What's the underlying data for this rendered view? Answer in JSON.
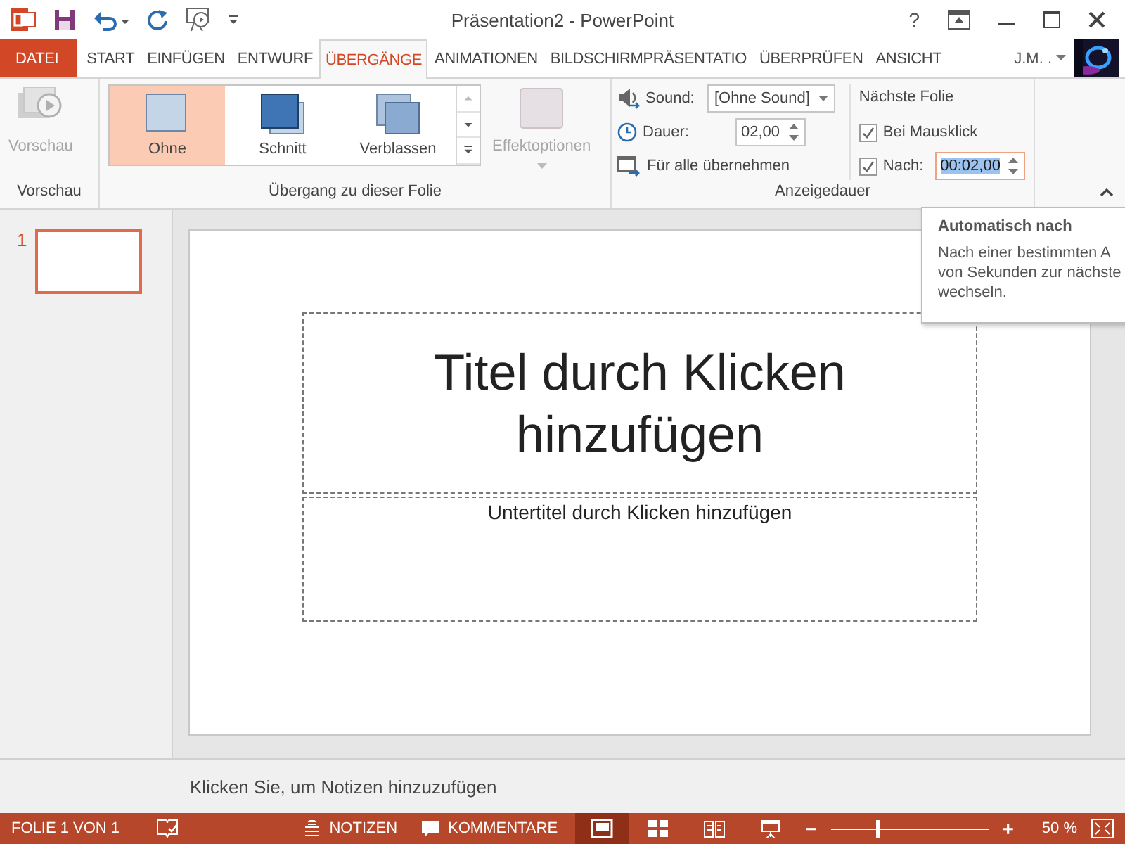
{
  "window": {
    "title": "Präsentation2 - PowerPoint",
    "help": "?"
  },
  "tabs": [
    {
      "label": "DATEI",
      "kind": "file",
      "selected": false
    },
    {
      "label": "START",
      "kind": "tab",
      "selected": false
    },
    {
      "label": "EINFÜGEN",
      "kind": "tab",
      "selected": false
    },
    {
      "label": "ENTWURF",
      "kind": "tab",
      "selected": false
    },
    {
      "label": "ÜBERGÄNGE",
      "kind": "tab",
      "selected": true
    },
    {
      "label": "ANIMATIONEN",
      "kind": "tab",
      "selected": false
    },
    {
      "label": "BILDSCHIRMPRÄSENTATIO",
      "kind": "tab",
      "selected": false
    },
    {
      "label": "ÜBERPRÜFEN",
      "kind": "tab",
      "selected": false
    },
    {
      "label": "ANSICHT",
      "kind": "tab",
      "selected": false
    }
  ],
  "user": {
    "name": "J.M. ."
  },
  "ribbon": {
    "preview_group": {
      "button": "Vorschau",
      "disabled": true,
      "label": "Vorschau"
    },
    "transition_group": {
      "label": "Übergang zu dieser Folie",
      "items": [
        {
          "label": "Ohne",
          "kind": "none",
          "selected": true
        },
        {
          "label": "Schnitt",
          "kind": "cut",
          "selected": false
        },
        {
          "label": "Verblassen",
          "kind": "fade",
          "selected": false
        }
      ],
      "effect_options": {
        "label": "Effektoptionen",
        "disabled": true
      }
    },
    "timing_group": {
      "label": "Anzeigedauer",
      "sound_label": "Sound:",
      "sound_value": "[Ohne Sound]",
      "duration_label": "Dauer:",
      "duration_value": "02,00",
      "apply_all": "Für alle übernehmen",
      "next_slide_heading": "Nächste Folie",
      "on_click": {
        "label": "Bei Mausklick",
        "checked": true
      },
      "after": {
        "label": "Nach:",
        "checked": true,
        "value": "00:02,00"
      }
    }
  },
  "thumbnails": [
    {
      "number": "1",
      "selected": true
    }
  ],
  "slide": {
    "title_placeholder": "Titel durch Klicken hinzufügen",
    "subtitle_placeholder": "Untertitel durch Klicken hinzufügen"
  },
  "notes": {
    "placeholder": "Klicken Sie, um Notizen hinzuzufügen"
  },
  "tooltip": {
    "title": "Automatisch nach",
    "lines": [
      "Nach einer bestimmten A",
      "von Sekunden zur nächste",
      "wechseln."
    ]
  },
  "status_bar": {
    "slide_info": "FOLIE 1 VON 1",
    "notes": "NOTIZEN",
    "comments": "KOMMENTARE",
    "views": [
      {
        "kind": "normal",
        "selected": true
      },
      {
        "kind": "sorter",
        "selected": false
      },
      {
        "kind": "reading",
        "selected": false
      },
      {
        "kind": "slideshow",
        "selected": false
      }
    ],
    "zoom_out": "−",
    "zoom": {
      "level": 0.3
    },
    "zoom_in": "+",
    "zoom_percent": "50 %"
  }
}
